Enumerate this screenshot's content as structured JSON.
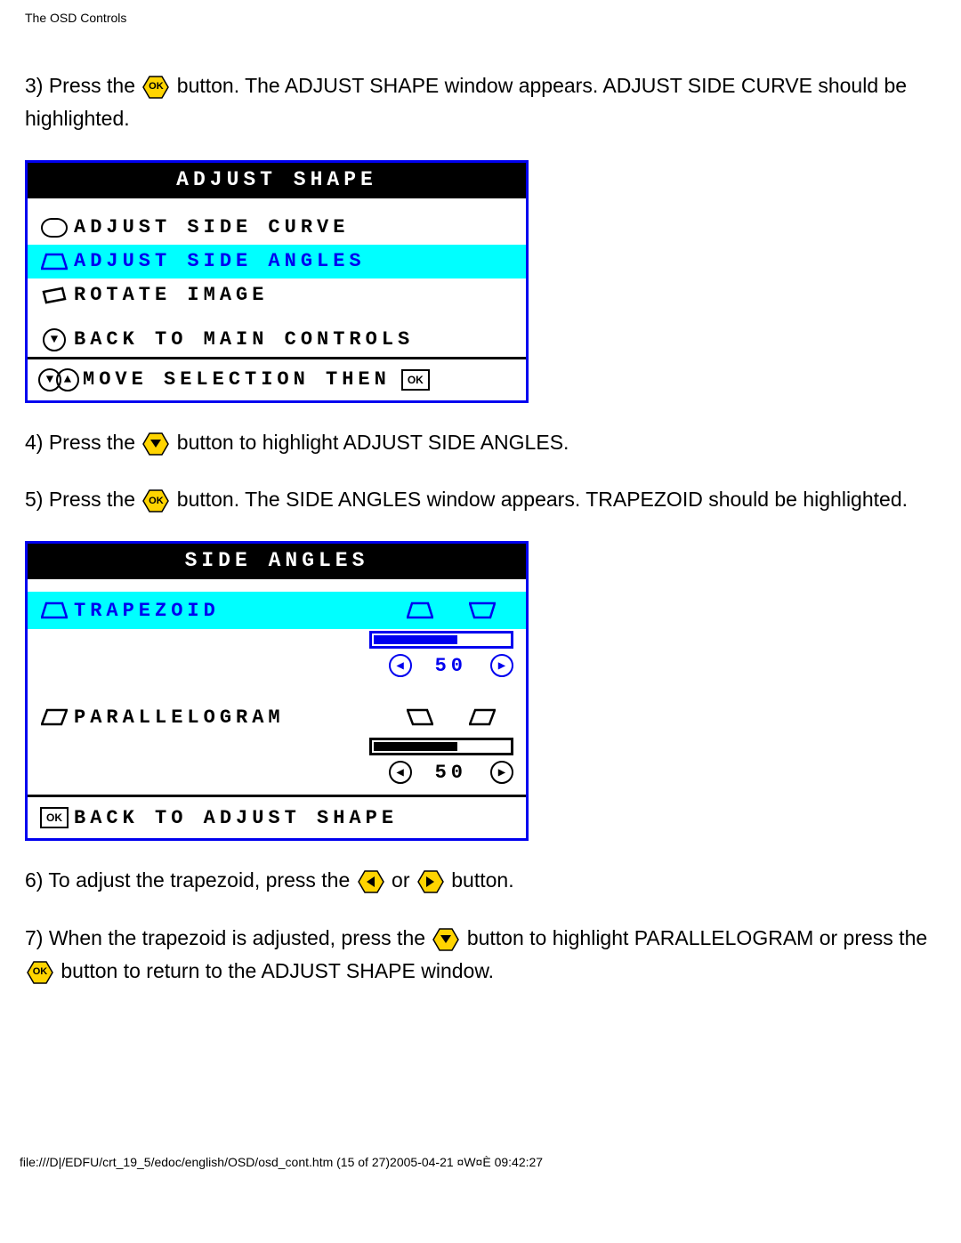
{
  "header": {
    "title": "The OSD Controls"
  },
  "step3": {
    "pre": "3) Press the ",
    "post": " button. The ADJUST SHAPE window appears. ADJUST SIDE CURVE should be highlighted."
  },
  "osd1": {
    "title": "ADJUST SHAPE",
    "items": [
      {
        "label": "ADJUST SIDE CURVE"
      },
      {
        "label": "ADJUST SIDE ANGLES"
      },
      {
        "label": "ROTATE IMAGE"
      }
    ],
    "back": "BACK TO MAIN CONTROLS",
    "hint": "MOVE SELECTION THEN"
  },
  "step4": {
    "pre": "4) Press the ",
    "post": " button to highlight ADJUST SIDE ANGLES."
  },
  "step5": {
    "pre": "5) Press the ",
    "post": " button. The SIDE ANGLES window appears. TRAPEZOID should be highlighted."
  },
  "osd2": {
    "title": "SIDE ANGLES",
    "trapezoid": {
      "label": "TRAPEZOID",
      "value": "50",
      "fillPct": 60
    },
    "parallelogram": {
      "label": "PARALLELOGRAM",
      "value": "50",
      "fillPct": 60
    },
    "back": "BACK TO ADJUST SHAPE"
  },
  "step6": {
    "pre": "6) To adjust the trapezoid, press the ",
    "mid": " or ",
    "post": " button."
  },
  "step7": {
    "pre": "7) When the trapezoid is adjusted, press the ",
    "mid": " button to highlight PARALLELOGRAM or press the ",
    "post": " button to return to the ADJUST SHAPE window."
  },
  "footer": {
    "text": "file:///D|/EDFU/crt_19_5/edoc/english/OSD/osd_cont.htm (15 of 27)2005-04-21 ¤W¤È 09:42:27"
  }
}
